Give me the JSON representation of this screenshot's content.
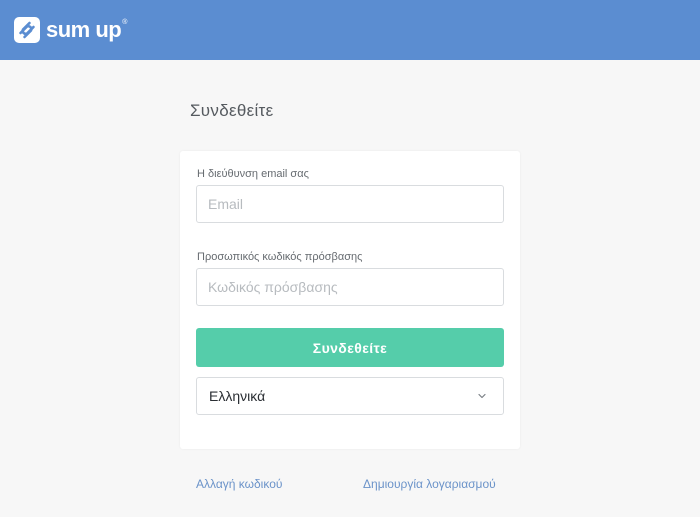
{
  "header": {
    "logo_text": "sum up",
    "logo_reg": "®",
    "logo_icon": "sumup-logo-icon",
    "bar_color": "#5b8dd1"
  },
  "login": {
    "title": "Συνδεθείτε",
    "email_label": "Η διεύθυνση email σας",
    "email_placeholder": "Email",
    "email_value": "",
    "password_label": "Προσωπικός κωδικός πρόσβασης",
    "password_placeholder": "Κωδικός πρόσβασης",
    "password_value": "",
    "submit_label": "Συνδεθείτε",
    "submit_color": "#55cdaa",
    "language_selected": "Ελληνικά",
    "language_icon": "chevron-down-icon"
  },
  "links": {
    "change_password": "Αλλαγή κωδικού",
    "create_account": "Δημιουργία λογαριασμού"
  }
}
